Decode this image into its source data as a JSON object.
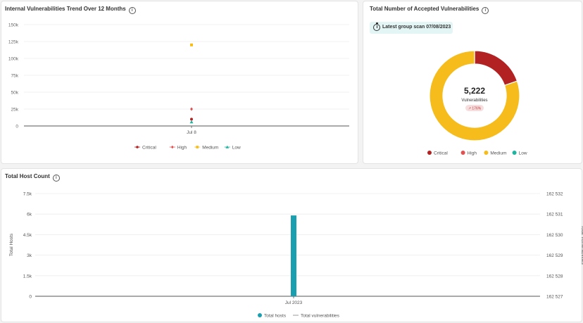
{
  "trend_panel": {
    "title": "Internal Vulnerabilities Trend Over 12 Months",
    "info_icon": "info-icon"
  },
  "accepted_panel": {
    "title": "Total Number of Accepted Vulnerabilities",
    "info_icon": "info-icon",
    "scan_badge": "Latest group scan 07/08/2023",
    "scan_icon": "stopwatch-icon",
    "total": "5,222",
    "total_label": "Vulnerabilities",
    "change": "↗ 176%"
  },
  "host_panel": {
    "title": "Total Host Count",
    "info_icon": "info-icon"
  },
  "colors": {
    "critical": "#b22222",
    "high": "#e05252",
    "medium": "#f5bc1c",
    "low": "#20b4a0",
    "hosts_bar": "#1a9fb0",
    "total_vuln_line": "#999999"
  },
  "chart_data": [
    {
      "type": "scatter",
      "categories": [
        "Jul 8"
      ],
      "series": [
        {
          "name": "Critical",
          "values": [
            10000
          ],
          "marker": "circle",
          "color": "#b22222"
        },
        {
          "name": "High",
          "values": [
            25000
          ],
          "marker": "star",
          "color": "#e05252"
        },
        {
          "name": "Medium",
          "values": [
            120000
          ],
          "marker": "square",
          "color": "#f5bc1c"
        },
        {
          "name": "Low",
          "values": [
            6000
          ],
          "marker": "triangle",
          "color": "#20b4a0"
        }
      ],
      "y_ticks": [
        "0",
        "25k",
        "50k",
        "75k",
        "100k",
        "125k",
        "150k"
      ],
      "ylim": [
        0,
        150000
      ],
      "grid": true,
      "legend": "bottom"
    },
    {
      "type": "pie",
      "donut": true,
      "labels": [
        "Critical",
        "High",
        "Medium",
        "Low"
      ],
      "values": [
        1030,
        0,
        4192,
        0
      ],
      "colors": [
        "#b22222",
        "#e05252",
        "#f5bc1c",
        "#20b4a0"
      ],
      "legend": "bottom"
    },
    {
      "type": "bar",
      "categories": [
        "Jul 2023"
      ],
      "series": [
        {
          "name": "Total hosts",
          "values": [
            5900
          ],
          "axis": "left"
        },
        {
          "name": "Total vulnerabilities",
          "values": [],
          "axis": "right",
          "style": "line"
        }
      ],
      "ylabel": "Total Hosts",
      "y2label": "Total Vulnerabilities",
      "y_ticks": [
        "0",
        "1.5k",
        "3k",
        "4.5k",
        "6k",
        "7.5k"
      ],
      "y2_ticks": [
        "162 527",
        "162 528",
        "162 529",
        "162 530",
        "162 531",
        "162 532"
      ],
      "ylim": [
        0,
        7500
      ],
      "grid": true,
      "legend": "bottom"
    }
  ]
}
